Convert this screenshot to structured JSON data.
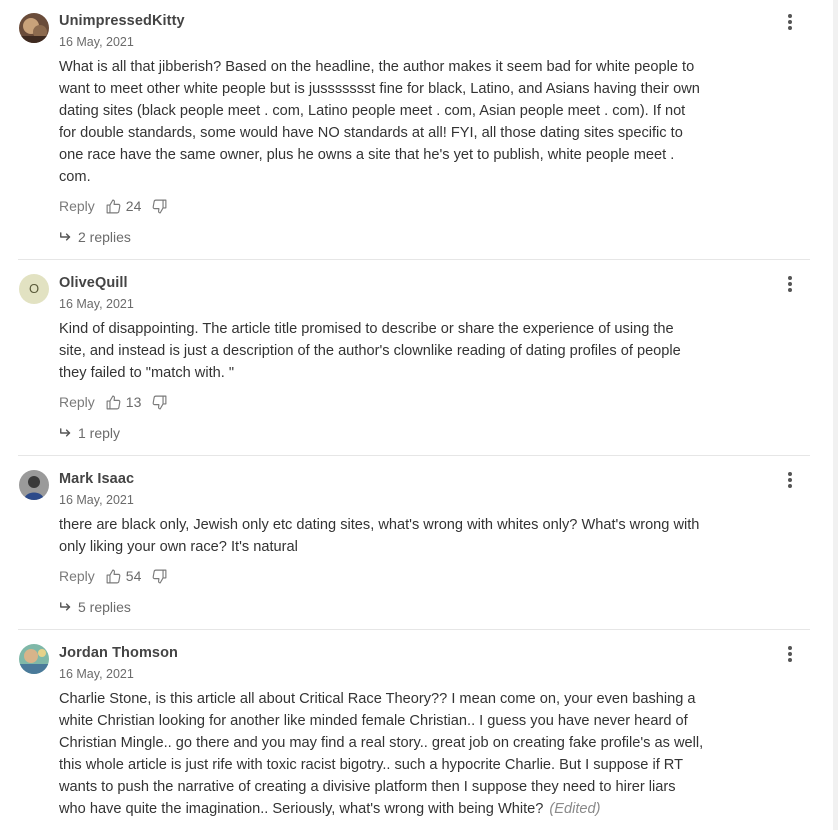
{
  "ui": {
    "reply_label": "Reply"
  },
  "comments": [
    {
      "username": "UnimpressedKitty",
      "date": "16 May, 2021",
      "avatar": "photo",
      "lines": [
        "What is all that jibberish?   Based on the headline, the author makes it seem bad for white people to",
        "want to meet other white people but is jussssssst fine for black, Latino, and Asians having their own",
        "dating sites (black people meet . com, Latino people meet . com, Asian people meet . com).  If not",
        "for double standards, some would have NO standards at all!  FYI, all those dating sites specific to",
        "one race have the same owner, plus he owns a site that he's yet to publish, white people meet .",
        "com."
      ],
      "likes": "24",
      "replies": "2 replies"
    },
    {
      "username": "OliveQuill",
      "date": "16 May, 2021",
      "avatar": "initial",
      "avatar_initial": "O",
      "lines": [
        "Kind of disappointing. The article title promised to describe or share the experience of using the",
        "site, and instead is just a description of the author's clownlike reading of dating profiles of people",
        "they failed to \"match with. \""
      ],
      "likes": "13",
      "replies": "1 reply"
    },
    {
      "username": "Mark Isaac",
      "date": "16 May, 2021",
      "avatar": "photo",
      "lines": [
        "there are black only, Jewish only etc dating sites, what's wrong with whites only? What's wrong with",
        "only liking your own race? It's natural"
      ],
      "likes": "54",
      "replies": "5 replies"
    },
    {
      "username": "Jordan Thomson",
      "date": "16 May, 2021",
      "avatar": "photo",
      "lines": [
        "Charlie Stone, is this article all about Critical Race Theory?? I mean come on, your even bashing a",
        "white Christian looking for another like minded female Christian.. I guess you have never heard of",
        "Christian Mingle.. go there and you may find a real story.. great job on creating fake profile's as well,",
        "this whole article is just rife with toxic racist bigotry.. such a hypocrite Charlie. But I suppose if RT",
        "wants to push the narrative of creating a divisive platform then I suppose they need to hirer liars",
        "who have quite the imagination..  Seriously, what's wrong with being White?"
      ],
      "edited": "(Edited)"
    }
  ],
  "colors": {
    "text": "#333333",
    "muted": "#6b6b6b",
    "divider": "#e6e6e6",
    "initial_avatar_bg": "#e2e2c2"
  },
  "icons": [
    "thumbs-up-icon",
    "thumbs-down-icon",
    "reply-arrow-icon",
    "more-options-icon"
  ]
}
